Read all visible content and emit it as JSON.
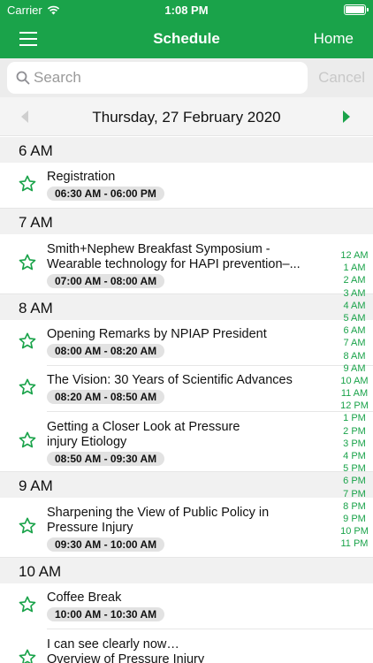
{
  "status_bar": {
    "carrier": "Carrier",
    "time": "1:08 PM"
  },
  "nav_bar": {
    "title": "Schedule",
    "home_label": "Home"
  },
  "search": {
    "placeholder": "Search",
    "cancel_label": "Cancel"
  },
  "date_bar": {
    "date": "Thursday, 27 February 2020"
  },
  "colors": {
    "accent": "#1aa34a",
    "header_bg": "#f1f1f1",
    "badge_bg": "#e2e2e2"
  },
  "schedule": [
    {
      "hour": "6 AM",
      "events": [
        {
          "title": [
            "Registration"
          ],
          "time": "06:30 AM - 06:00 PM"
        }
      ]
    },
    {
      "hour": "7 AM",
      "events": [
        {
          "title": [
            "Smith+Nephew Breakfast Symposium -",
            "Wearable technology for HAPI prevention–..."
          ],
          "time": "07:00 AM - 08:00 AM"
        }
      ]
    },
    {
      "hour": "8 AM",
      "events": [
        {
          "title": [
            "Opening Remarks by NPIAP President"
          ],
          "time": "08:00 AM - 08:20 AM"
        },
        {
          "title": [
            "The Vision:  30 Years of Scientific Advances"
          ],
          "time": "08:20 AM - 08:50 AM"
        },
        {
          "title": [
            "Getting a Closer Look at Pressure",
            "injury Etiology"
          ],
          "time": "08:50 AM - 09:30 AM"
        }
      ]
    },
    {
      "hour": "9 AM",
      "events": [
        {
          "title": [
            "Sharpening the View of Public Policy in",
            "Pressure Injury"
          ],
          "time": "09:30 AM - 10:00 AM"
        }
      ]
    },
    {
      "hour": "10 AM",
      "events": [
        {
          "title": [
            "Coffee Break"
          ],
          "time": "10:00 AM - 10:30 AM"
        },
        {
          "title": [
            "I can see clearly now…",
            "Overview of Pressure Injury"
          ],
          "time": ""
        }
      ]
    }
  ],
  "hour_index": [
    "12 AM",
    "1 AM",
    "2 AM",
    "3 AM",
    "4 AM",
    "5 AM",
    "6 AM",
    "7 AM",
    "8 AM",
    "9 AM",
    "10 AM",
    "11 AM",
    "12 PM",
    "1 PM",
    "2 PM",
    "3 PM",
    "4 PM",
    "5 PM",
    "6 PM",
    "7 PM",
    "8 PM",
    "9 PM",
    "10 PM",
    "11 PM"
  ]
}
